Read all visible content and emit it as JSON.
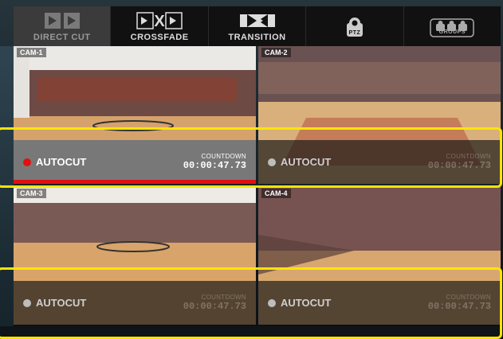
{
  "toolbar": {
    "tabs": [
      {
        "label": "DIRECT CUT",
        "icon": "direct-cut-icon",
        "active": true
      },
      {
        "label": "CROSSFADE",
        "icon": "crossfade-icon",
        "active": false
      },
      {
        "label": "TRANSITION",
        "icon": "transition-icon",
        "active": false
      },
      {
        "label": "PTZ",
        "icon": "ptz-camera-icon",
        "active": false
      },
      {
        "label": "GROUPS",
        "icon": "groups-icon",
        "active": false
      }
    ]
  },
  "cameras": [
    {
      "label": "CAM-1",
      "status": "AUTOCUT",
      "countdown_label": "COUNTDOWN",
      "countdown": "00:00:47.73",
      "live": true
    },
    {
      "label": "CAM-2",
      "status": "AUTOCUT",
      "countdown_label": "COUNTDOWN",
      "countdown": "00:00:47.73",
      "live": false
    },
    {
      "label": "CAM-3",
      "status": "AUTOCUT",
      "countdown_label": "COUNTDOWN",
      "countdown": "00:00:47.73",
      "live": false
    },
    {
      "label": "CAM-4",
      "status": "AUTOCUT",
      "countdown_label": "COUNTDOWN",
      "countdown": "00:00:47.73",
      "live": false
    }
  ],
  "colors": {
    "live_dot": "#e01010",
    "idle_dot": "#bdbdbd",
    "highlight": "#ffe400"
  }
}
